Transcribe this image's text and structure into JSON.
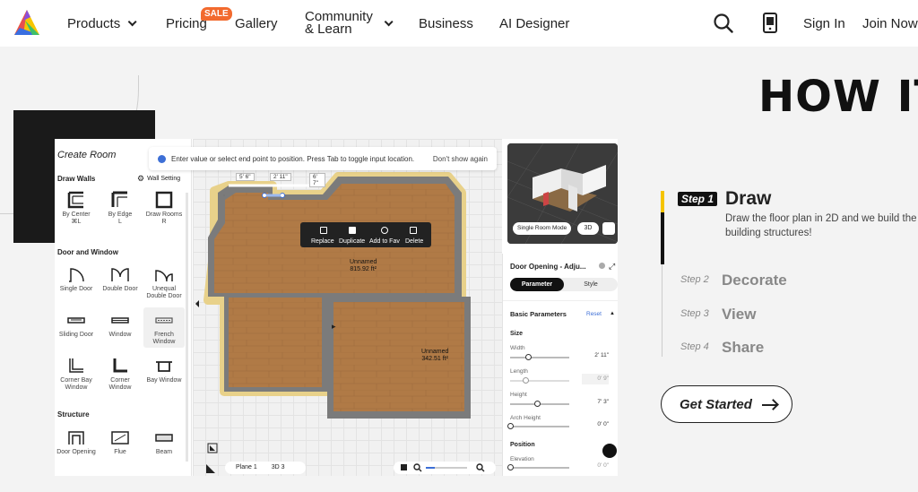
{
  "nav": {
    "items": [
      "Products",
      "Pricing",
      "Gallery",
      "Community",
      "& Learn",
      "Business",
      "AI Designer"
    ],
    "sale_badge": "SALE",
    "sign_in": "Sign In",
    "join_now": "Join Now"
  },
  "hero": {
    "title": "HOW IT"
  },
  "app": {
    "sidebar_title": "Create Room",
    "draw_walls": "Draw Walls",
    "wall_setting": "Wall Setting",
    "wall_tools": [
      {
        "label": "By Center",
        "shortcut": "⌘L"
      },
      {
        "label": "By Edge",
        "shortcut": "L"
      },
      {
        "label": "Draw Rooms",
        "shortcut": "R"
      }
    ],
    "door_window": "Door and Window",
    "door_tools": [
      "Single Door",
      "Double Door",
      "Unequal Double Door",
      "Sliding Door",
      "Window",
      "French Window",
      "Corner Bay Window",
      "Corner Window",
      "Bay Window"
    ],
    "structure": "Structure",
    "structure_tools": [
      "Door Opening",
      "Flue",
      "Beam"
    ],
    "tip": "Enter value or select end point to position. Press Tab to toggle input location.",
    "tip_dismiss": "Don't show again",
    "dimensions": [
      "5' 6\"",
      "2' 11\"",
      "6' 7\""
    ],
    "context_menu": [
      "Replace",
      "Duplicate",
      "Add to Fav",
      "Delete"
    ],
    "rooms": [
      {
        "name": "Unnamed",
        "area": "815.92 ft²"
      },
      {
        "name": "Unnamed",
        "area": "342.51 ft²"
      }
    ],
    "preview_mode": "Single Room Mode",
    "preview_3d": "3D",
    "bottom": {
      "plane": "Plane 1",
      "view": "3D 3"
    },
    "panel": {
      "title": "Door Opening - Adju...",
      "tab_param": "Parameter",
      "tab_style": "Style",
      "basic": "Basic Parameters",
      "reset": "Reset",
      "size": "Size",
      "width_label": "Width",
      "width_value": "2' 11\"",
      "width_level": 0.3,
      "length_label": "Length",
      "length_value": "0' 9\"",
      "length_level": 0.25,
      "height_label": "Height",
      "height_value": "7' 3\"",
      "height_level": 0.45,
      "arch_label": "Arch Height",
      "arch_value": "0' 0\"",
      "arch_level": 0.0,
      "position": "Position",
      "elevation_label": "Elevation",
      "elevation_value": "0' 0\""
    }
  },
  "steps": {
    "step1_badge": "Step 1",
    "step1_title": "Draw",
    "step1_desc": "Draw the floor plan in 2D and we build the building structures!",
    "items": [
      {
        "label": "Step 2",
        "title": "Decorate"
      },
      {
        "label": "Step 3",
        "title": "View"
      },
      {
        "label": "Step 4",
        "title": "Share"
      }
    ],
    "cta": "Get Started"
  },
  "colors": {
    "sale": "#f26a2e",
    "accent": "#f5c400",
    "wood": "#b07a46"
  }
}
